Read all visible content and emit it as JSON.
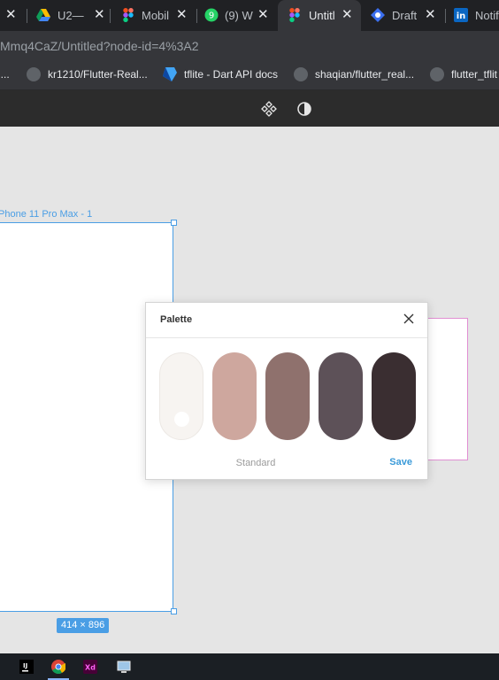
{
  "browser": {
    "tabs": [
      {
        "label": "",
        "icon": "close-icon",
        "active": false
      },
      {
        "label": "U2—",
        "icon": "google-drive-icon",
        "active": false
      },
      {
        "label": "Mobil",
        "icon": "figma-icon",
        "active": false
      },
      {
        "label": "(9) W",
        "icon": "whatsapp-icon",
        "active": false
      },
      {
        "label": "Untitl",
        "icon": "figma-icon",
        "active": true
      },
      {
        "label": "Draft",
        "icon": "draft-icon",
        "active": false
      },
      {
        "label": "Notif",
        "icon": "linkedin-icon",
        "active": false
      }
    ],
    "close_glyph": "✕",
    "url": "Mmq4CaZ/Untitled?node-id=4%3A2",
    "bookmarks": [
      {
        "label": "l...",
        "icon": "bookmark-icon"
      },
      {
        "label": "kr1210/Flutter-Real...",
        "icon": "github-icon"
      },
      {
        "label": "tflite - Dart API docs",
        "icon": "dart-icon"
      },
      {
        "label": "shaqian/flutter_real...",
        "icon": "github-icon"
      },
      {
        "label": "flutter_tflit",
        "icon": "github-icon"
      }
    ]
  },
  "figma": {
    "toolbar": {
      "tools": [
        "components-icon",
        "contrast-icon"
      ]
    },
    "canvas": {
      "frame_label": "Phone 11 Pro Max - 1",
      "frame_size": "414 × 896"
    }
  },
  "palette_dialog": {
    "title": "Palette",
    "swatches": [
      "#f7f4f1",
      "#cea79e",
      "#8f716d",
      "#5d5158",
      "#3a2e31"
    ],
    "selected_index": 0,
    "standard_label": "Standard",
    "save_label": "Save"
  },
  "taskbar": {
    "apps": [
      "intellij-icon",
      "chrome-icon",
      "adobe-xd-icon",
      "remote-desktop-icon"
    ]
  },
  "colors": {
    "selection_blue": "#4a9ee5",
    "accent_save": "#3a9ad9"
  }
}
